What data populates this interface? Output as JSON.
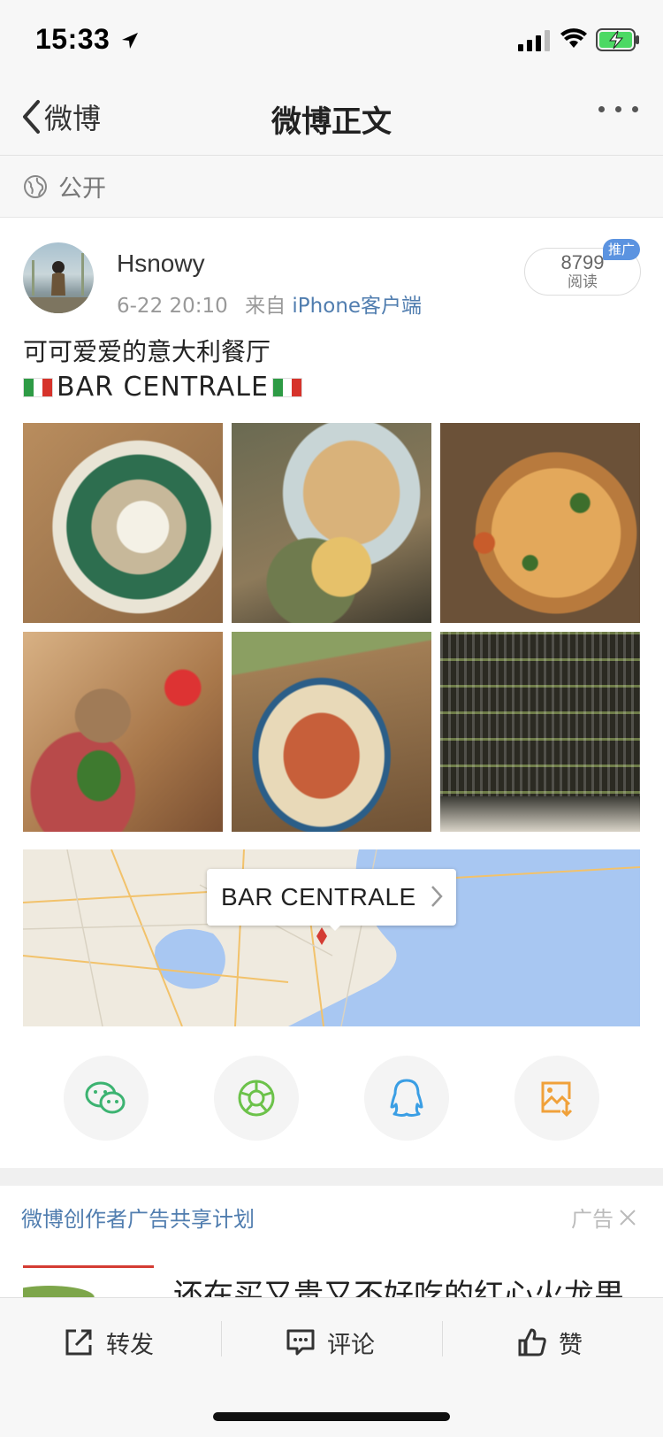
{
  "status_bar": {
    "time": "15:33"
  },
  "nav": {
    "back_label": "微博",
    "title": "微博正文"
  },
  "visibility": {
    "label": "公开"
  },
  "post": {
    "username": "Hsnowy",
    "datetime": "6-22 20:10",
    "source_prefix": "来自",
    "source": "iPhone客户端",
    "read_count": "8799",
    "read_label": "阅读",
    "promo_badge": "推广",
    "text_line1": "可可爱爱的意大利餐厅",
    "text_line2": "BAR CENTRALE",
    "photos": [
      "figs-burrata",
      "pasta-table",
      "pizza",
      "charcuterie-board",
      "seafood-pasta",
      "bar-shelves"
    ]
  },
  "location": {
    "name": "BAR CENTRALE"
  },
  "share": {
    "icons": [
      "wechat-icon",
      "moments-icon",
      "qq-icon",
      "save-image-icon"
    ]
  },
  "ad": {
    "title": "微博创作者广告共享计划",
    "label": "广告",
    "headline": "还在买又贵又不好吃的红心火龙果"
  },
  "toolbar": {
    "repost": "转发",
    "comment": "评论",
    "like": "赞"
  },
  "colors": {
    "link_blue": "#507daf",
    "promo_blue": "#5b93e0",
    "ad_red": "#d43c33"
  }
}
